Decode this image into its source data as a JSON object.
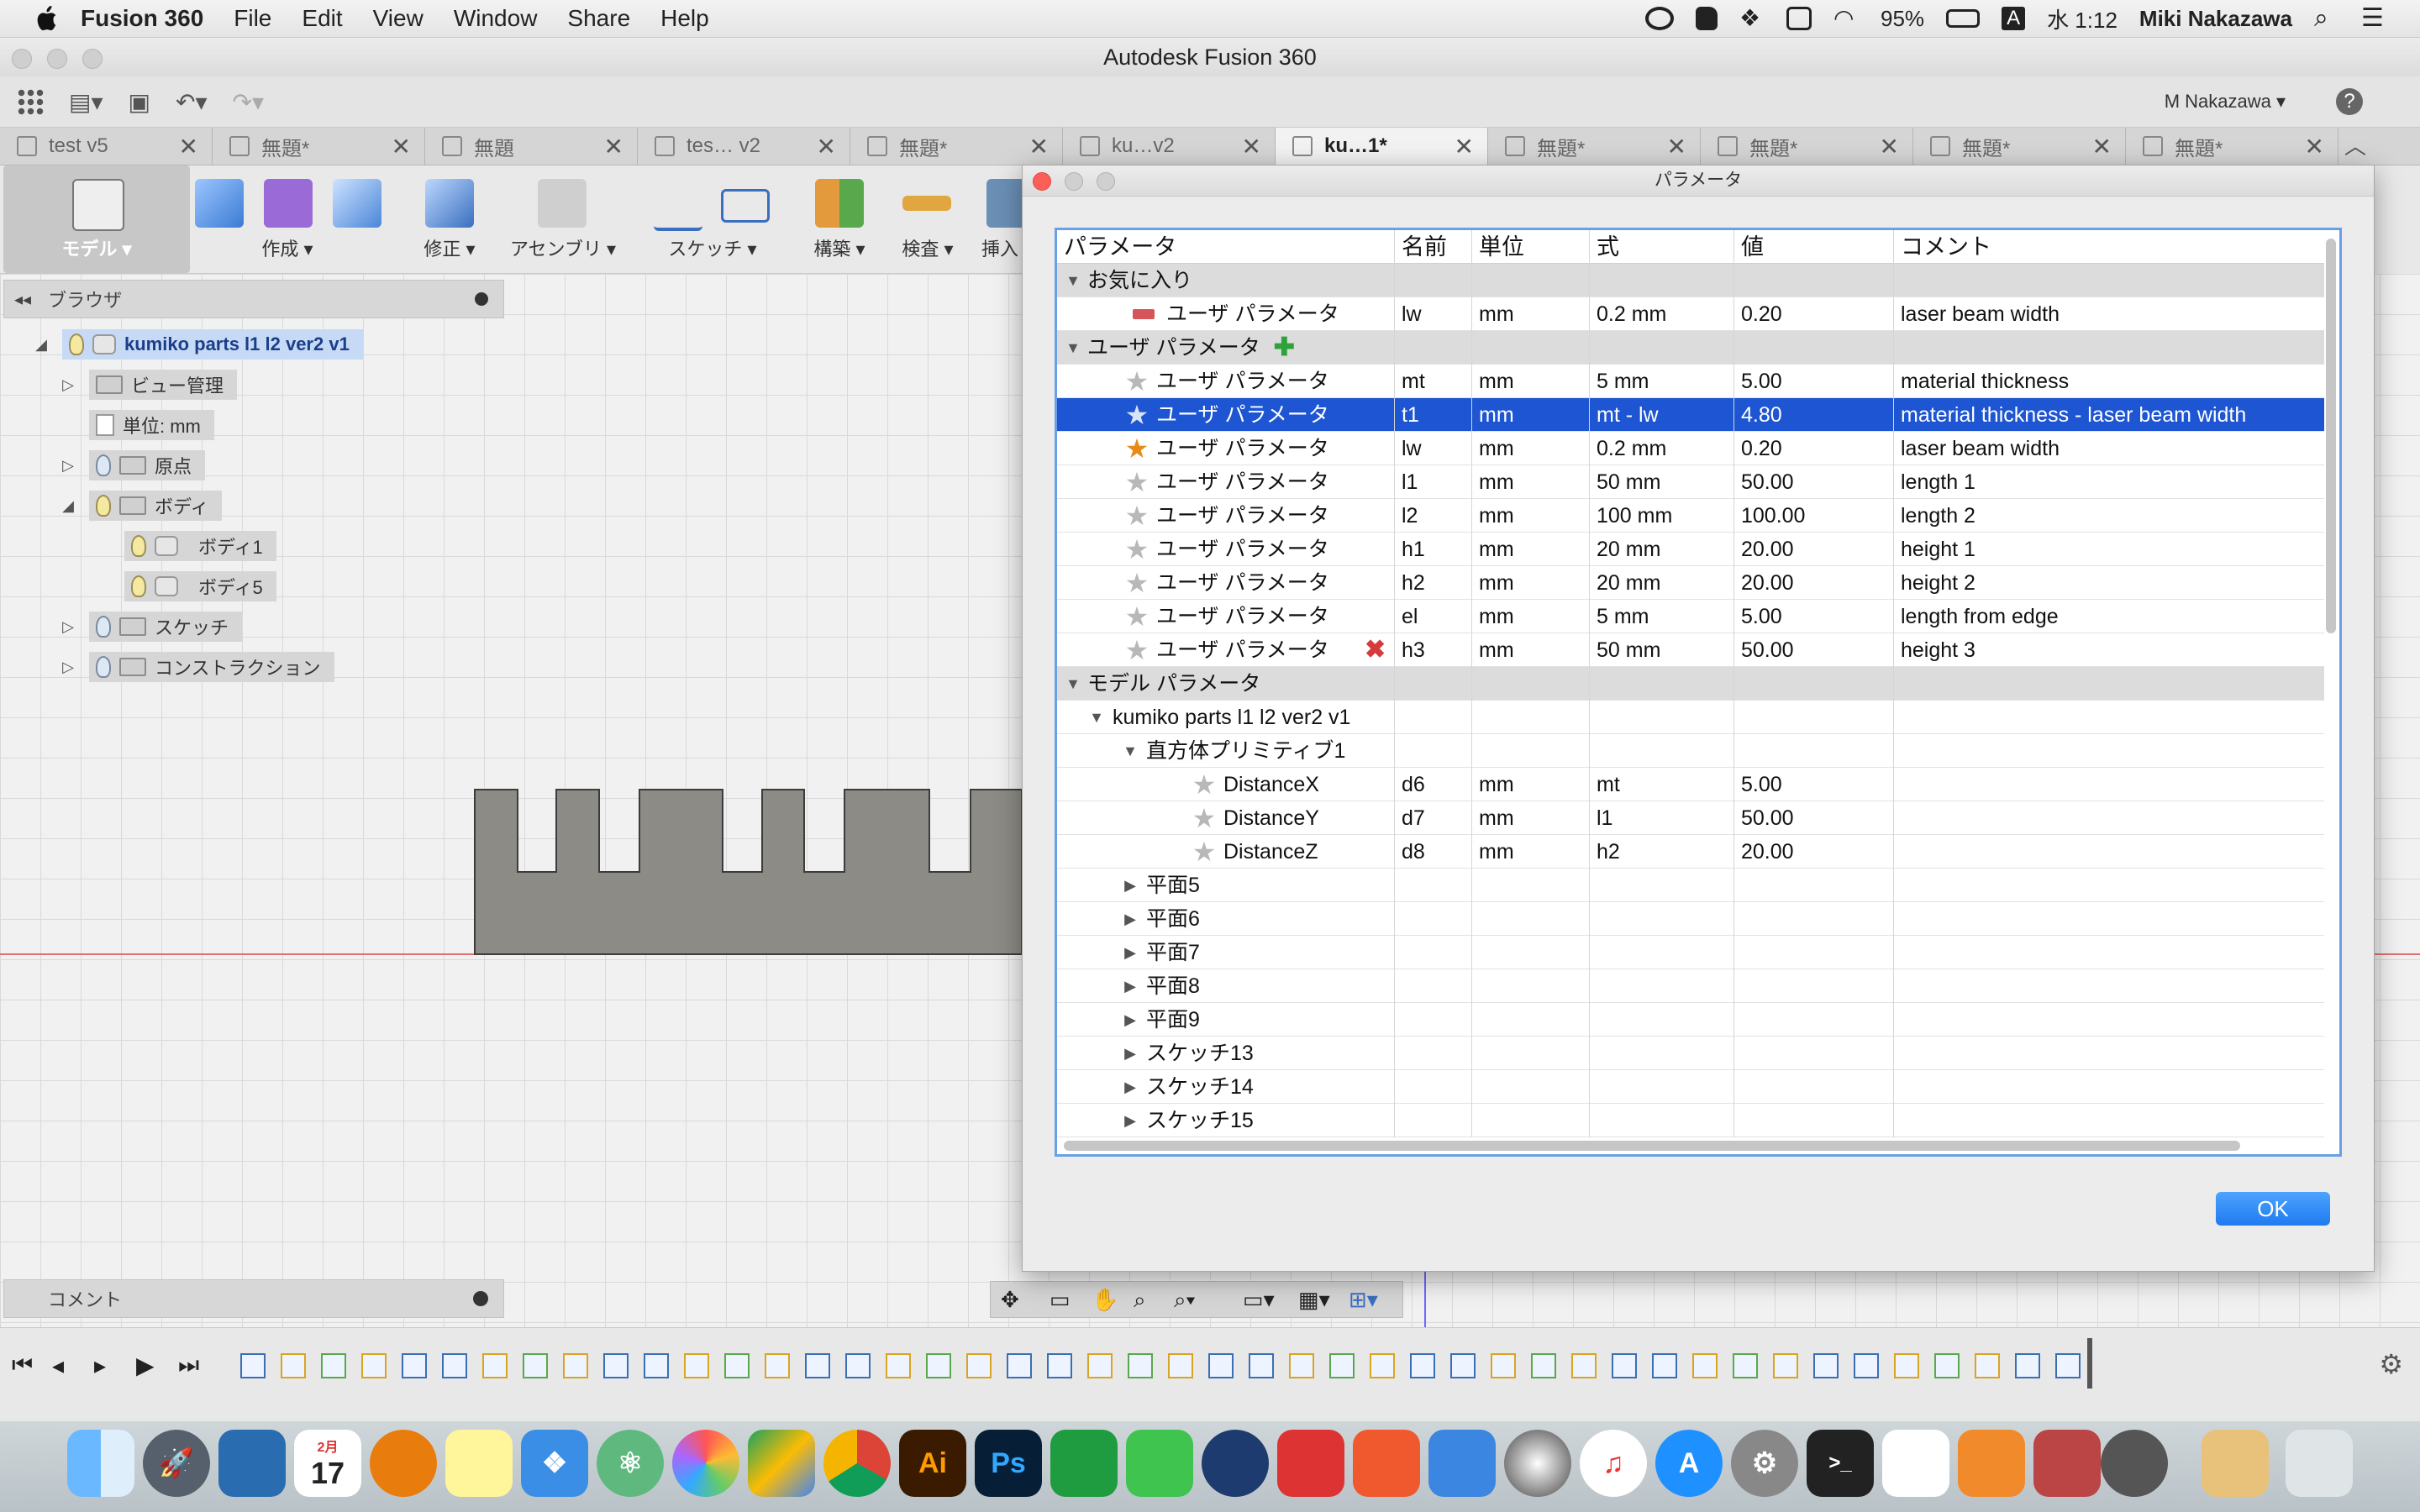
{
  "menubar": {
    "app_name": "Fusion 360",
    "menus": [
      "File",
      "Edit",
      "View",
      "Window",
      "Share",
      "Help"
    ],
    "battery": "95%",
    "input_mode": "A",
    "clock": "水 1:12",
    "user_name": "Miki Nakazawa",
    "icons": [
      "creative-cloud-icon",
      "evernote-icon",
      "dropbox-icon",
      "airplay-icon",
      "wifi-icon",
      "battery-icon",
      "search-icon",
      "list-icon"
    ]
  },
  "window": {
    "title": "Autodesk Fusion 360",
    "user_menu": "M Nakazawa",
    "help": "?"
  },
  "doc_tabs": [
    {
      "label": "test v5"
    },
    {
      "label": "無題*"
    },
    {
      "label": "無題"
    },
    {
      "label": "tes… v2"
    },
    {
      "label": "無題*"
    },
    {
      "label": "ku…v2"
    },
    {
      "label": "ku…1*",
      "active": true
    },
    {
      "label": "無題*"
    },
    {
      "label": "無題*"
    },
    {
      "label": "無題*"
    },
    {
      "label": "無題*"
    }
  ],
  "ribbon": {
    "workspace": "モデル",
    "groups": [
      "作成",
      "修正",
      "アセンブリ",
      "スケッチ",
      "構築",
      "検査",
      "挿入"
    ]
  },
  "browser": {
    "title": "ブラウザ",
    "root": "kumiko parts l1 l2 ver2 v1",
    "items": [
      {
        "label": "ビュー管理"
      },
      {
        "label": "単位: mm"
      },
      {
        "label": "原点"
      },
      {
        "label": "ボディ"
      },
      {
        "label": "ボディ1"
      },
      {
        "label": "ボディ5"
      },
      {
        "label": "スケッチ"
      },
      {
        "label": "コンストラクション"
      }
    ]
  },
  "comments": {
    "label": "コメント"
  },
  "dialog": {
    "title": "パラメータ",
    "ok": "OK",
    "columns": [
      "パラメータ",
      "名前",
      "単位",
      "式",
      "値",
      "コメント"
    ],
    "sections": {
      "favorites": "お気に入り",
      "user": "ユーザ パラメータ",
      "model": "モデル パラメータ"
    },
    "favorites": [
      {
        "param": "ユーザ パラメータ",
        "name": "lw",
        "unit": "mm",
        "expr": "0.2 mm",
        "value": "0.20",
        "comment": "laser beam width"
      }
    ],
    "user_params": [
      {
        "param": "ユーザ パラメータ",
        "name": "mt",
        "unit": "mm",
        "expr": "5 mm",
        "value": "5.00",
        "comment": "material thickness"
      },
      {
        "param": "ユーザ パラメータ",
        "name": "t1",
        "unit": "mm",
        "expr": "mt - lw",
        "value": "4.80",
        "comment": "material thickness - laser beam width"
      },
      {
        "param": "ユーザ パラメータ",
        "name": "lw",
        "unit": "mm",
        "expr": "0.2 mm",
        "value": "0.20",
        "comment": "laser beam width"
      },
      {
        "param": "ユーザ パラメータ",
        "name": "l1",
        "unit": "mm",
        "expr": "50 mm",
        "value": "50.00",
        "comment": "length 1"
      },
      {
        "param": "ユーザ パラメータ",
        "name": "l2",
        "unit": "mm",
        "expr": "100 mm",
        "value": "100.00",
        "comment": "length 2"
      },
      {
        "param": "ユーザ パラメータ",
        "name": "h1",
        "unit": "mm",
        "expr": "20 mm",
        "value": "20.00",
        "comment": "height 1"
      },
      {
        "param": "ユーザ パラメータ",
        "name": "h2",
        "unit": "mm",
        "expr": "20 mm",
        "value": "20.00",
        "comment": "height 2"
      },
      {
        "param": "ユーザ パラメータ",
        "name": "el",
        "unit": "mm",
        "expr": "5 mm",
        "value": "5.00",
        "comment": "length from edge"
      },
      {
        "param": "ユーザ パラメータ",
        "name": "h3",
        "unit": "mm",
        "expr": "50 mm",
        "value": "50.00",
        "comment": "height 3"
      }
    ],
    "model_root": "kumiko parts l1 l2 ver2 v1",
    "feature": "直方体プリミティブ1",
    "feature_params": [
      {
        "param": "DistanceX",
        "name": "d6",
        "unit": "mm",
        "expr": "mt",
        "value": "5.00"
      },
      {
        "param": "DistanceY",
        "name": "d7",
        "unit": "mm",
        "expr": "l1",
        "value": "50.00"
      },
      {
        "param": "DistanceZ",
        "name": "d8",
        "unit": "mm",
        "expr": "h2",
        "value": "20.00"
      }
    ],
    "collapsed_items": [
      "平面5",
      "平面6",
      "平面7",
      "平面8",
      "平面9",
      "スケッチ13",
      "スケッチ14",
      "スケッチ15"
    ]
  },
  "dock": {
    "items": [
      "finder-icon",
      "launchpad-icon",
      "calendar-icon",
      "blender-icon",
      "notes-icon",
      "dropbox-icon",
      "atom-icon",
      "photos-icon",
      "drive-icon",
      "chrome-icon",
      "illustrator-icon",
      "photoshop-icon",
      "evernote-icon",
      "facetime-icon",
      "sourcetree-icon",
      "app-icon",
      "swift-icon",
      "keynote-icon",
      "quicksilver-icon",
      "itunes-icon",
      "appstore-icon",
      "system-preferences-icon",
      "terminal-icon",
      "launcher-icon",
      "fusion360-icon",
      "app-icon-2",
      "photo-app-icon",
      "package-icon",
      "trash-icon"
    ],
    "calendar_month": "2月",
    "calendar_day": "17",
    "illustrator": "Ai",
    "photoshop": "Ps"
  }
}
